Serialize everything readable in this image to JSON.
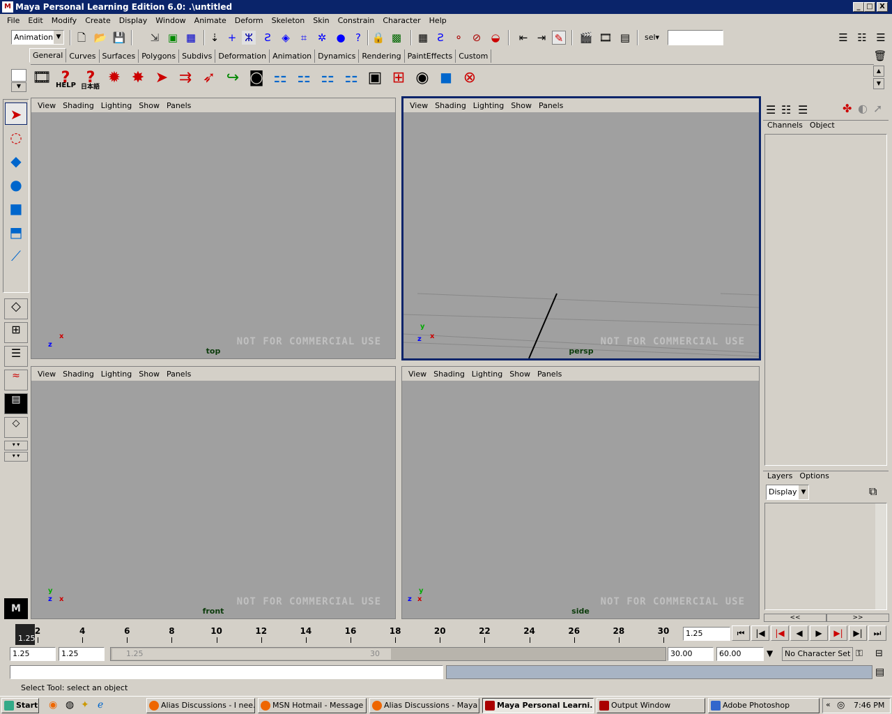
{
  "window": {
    "title": "Maya Personal Learning Edition 6.0: .\\untitled",
    "logo": "M",
    "min": "_",
    "max": "□",
    "close": "X"
  },
  "menu": [
    "File",
    "Edit",
    "Modify",
    "Create",
    "Display",
    "Window",
    "Animate",
    "Deform",
    "Skeleton",
    "Skin",
    "Constrain",
    "Character",
    "Help"
  ],
  "statusline": {
    "menuset": "Animation",
    "sel_label": "sel▾",
    "sel_value": ""
  },
  "shelf": {
    "tabs": [
      "General",
      "Curves",
      "Surfaces",
      "Polygons",
      "Subdivs",
      "Deformation",
      "Animation",
      "Dynamics",
      "Rendering",
      "PaintEffects",
      "Custom"
    ],
    "active_tab": "General",
    "help_label": "HELP",
    "jp_label": "日本語"
  },
  "viewports": [
    {
      "id": "top",
      "menu": [
        "View",
        "Shading",
        "Lighting",
        "Show",
        "Panels"
      ],
      "label": "top",
      "watermark": "NOT FOR COMMERCIAL USE",
      "axis_a": "x",
      "axis_b": "z",
      "selected": false
    },
    {
      "id": "persp",
      "menu": [
        "View",
        "Shading",
        "Lighting",
        "Show",
        "Panels"
      ],
      "label": "persp",
      "watermark": "NOT FOR COMMERCIAL USE",
      "axis_a": "x",
      "axis_b": "z",
      "axis_c": "y",
      "selected": true
    },
    {
      "id": "front",
      "menu": [
        "View",
        "Shading",
        "Lighting",
        "Show",
        "Panels"
      ],
      "label": "front",
      "watermark": "NOT FOR COMMERCIAL USE",
      "axis_a": "x",
      "axis_b": "z",
      "axis_c": "y",
      "selected": false
    },
    {
      "id": "side",
      "menu": [
        "View",
        "Shading",
        "Lighting",
        "Show",
        "Panels"
      ],
      "label": "side",
      "watermark": "NOT FOR COMMERCIAL USE",
      "axis_a": "z",
      "axis_b": "x",
      "axis_c": "y",
      "selected": false
    }
  ],
  "channelbox": {
    "menu": [
      "Channels",
      "Object"
    ]
  },
  "layers": {
    "menu": [
      "Layers",
      "Options"
    ],
    "display": "Display",
    "left_arrows": "<<",
    "right_arrows": ">>"
  },
  "time": {
    "ticks": [
      "2",
      "4",
      "6",
      "8",
      "10",
      "12",
      "14",
      "16",
      "18",
      "20",
      "22",
      "24",
      "26",
      "28",
      "30"
    ],
    "current": "1.25",
    "current_field": "1.25",
    "start": "1.25",
    "playback_start": "1.25",
    "range_start": "1.25",
    "range_end": "30",
    "playback_end": "30.00",
    "end": "60.00",
    "character_set": "No Character Set"
  },
  "status": {
    "help_line": "Select Tool: select an object"
  },
  "taskbar": {
    "start": "Start",
    "tasks": [
      "Alias Discussions - I nee...",
      "MSN Hotmail - Message -...",
      "Alias Discussions - Maya ...",
      "Maya Personal Learni...",
      "Output Window",
      "Adobe Photoshop"
    ],
    "clock": "7:46 PM",
    "tray_arrow": "«"
  },
  "colors": {
    "titlebar": "#0a246a",
    "viewport": "#a0a0a0",
    "selected_border": "#0a246a"
  }
}
